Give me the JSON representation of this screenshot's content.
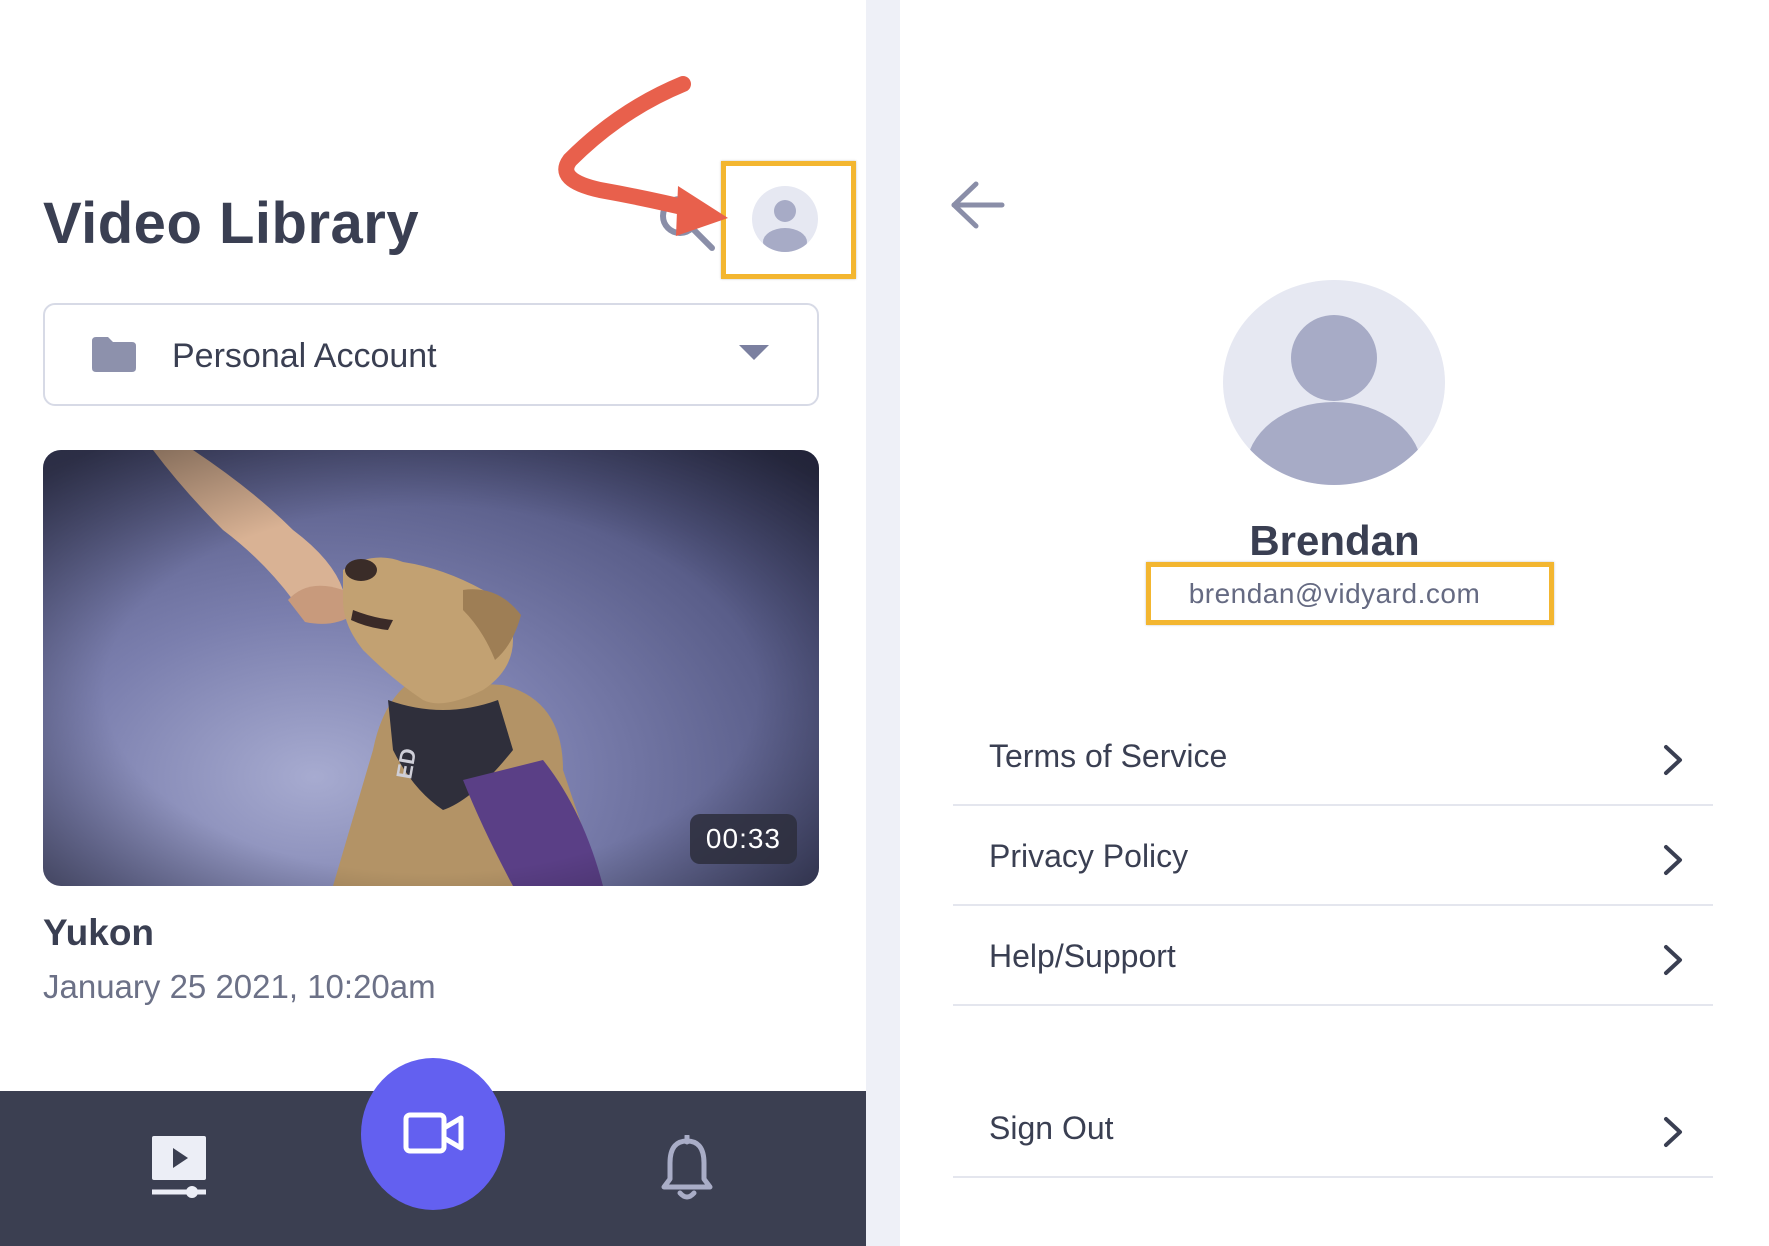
{
  "library": {
    "title": "Video Library",
    "account_selector": {
      "label": "Personal Account"
    },
    "video": {
      "title": "Yukon",
      "date": "January 25 2021, 10:20am",
      "duration": "00:33"
    }
  },
  "bottom_nav": {
    "items": [
      {
        "icon": "video-library-icon"
      },
      {
        "icon": "camera-icon"
      },
      {
        "icon": "bell-icon"
      }
    ],
    "accent": "#6360f0"
  },
  "profile": {
    "name": "Brendan",
    "email": "brendan@vidyard.com",
    "menu": [
      {
        "label": "Terms of Service"
      },
      {
        "label": "Privacy Policy"
      },
      {
        "label": "Help/Support"
      },
      {
        "label": "Sign Out"
      }
    ]
  },
  "annotation_colors": {
    "highlight": "#f3b630",
    "arrow": "#e8604c"
  }
}
